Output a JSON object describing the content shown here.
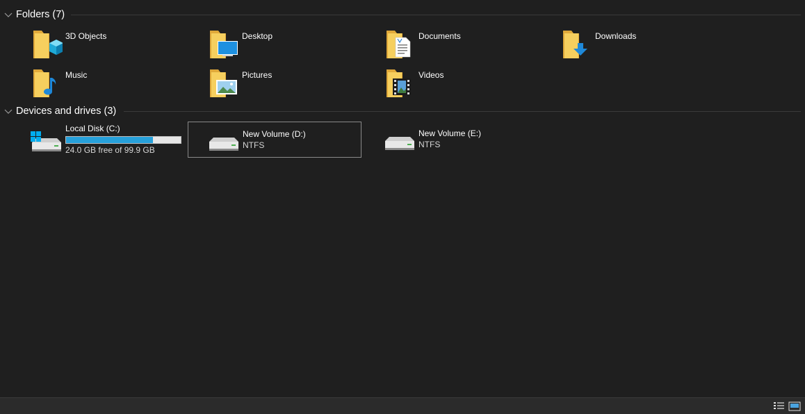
{
  "groups": {
    "folders": {
      "title": "Folders (7)"
    },
    "drives": {
      "title": "Devices and drives (3)"
    }
  },
  "folders": [
    {
      "label": "3D Objects",
      "icon": "3d-objects-folder-icon"
    },
    {
      "label": "Desktop",
      "icon": "desktop-folder-icon"
    },
    {
      "label": "Documents",
      "icon": "documents-folder-icon"
    },
    {
      "label": "Downloads",
      "icon": "downloads-folder-icon"
    },
    {
      "label": "Music",
      "icon": "music-folder-icon"
    },
    {
      "label": "Pictures",
      "icon": "pictures-folder-icon"
    },
    {
      "label": "Videos",
      "icon": "videos-folder-icon"
    }
  ],
  "drives": [
    {
      "name": "Local Disk (C:)",
      "info": "24.0 GB free of 99.9 GB",
      "used_fraction": 0.76,
      "icon": "system-drive-icon"
    },
    {
      "name": "New Volume (D:)",
      "info": "NTFS",
      "icon": "hard-drive-icon"
    },
    {
      "name": "New Volume (E:)",
      "info": "NTFS",
      "icon": "hard-drive-icon"
    }
  ],
  "colors": {
    "background": "#1f1f1f",
    "folder": "#f5c84c",
    "accent": "#26a0da",
    "selection_border": "#8a8a8a"
  },
  "statusbar": {
    "details_view_icon": "details-view-icon",
    "large_icons_view_icon": "large-icons-view-icon"
  }
}
